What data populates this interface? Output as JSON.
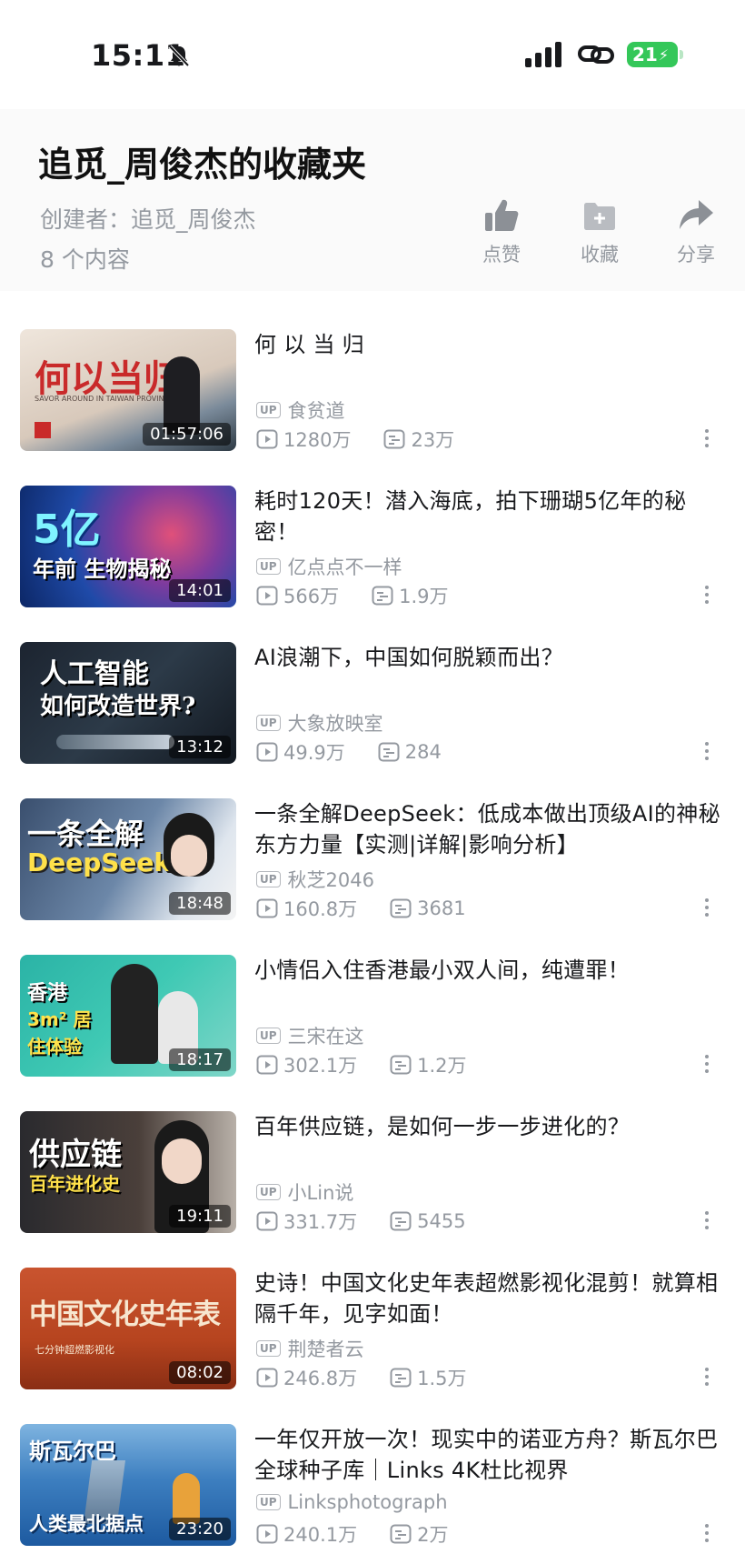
{
  "status": {
    "time": "15:11",
    "battery": "21"
  },
  "header": {
    "title": "追觅_周俊杰的收藏夹",
    "creator": "创建者：追觅_周俊杰",
    "count": "8 个内容",
    "actions": {
      "like": "点赞",
      "collect": "收藏",
      "share": "分享"
    }
  },
  "videos": [
    {
      "title": "何 以 当 归",
      "thumb_text": "何以当归",
      "thumb_sub": "SAVOR AROUND IN TAIWAN PROVINCE",
      "duration": "01:57:06",
      "up": "食贫道",
      "views": "1280万",
      "danmaku": "23万"
    },
    {
      "title": "耗时120天！潜入海底，拍下珊瑚5亿年的秘密！",
      "thumb_text": "5亿",
      "thumb_sub": "年前 生物揭秘",
      "duration": "14:01",
      "up": "亿点点不一样",
      "views": "566万",
      "danmaku": "1.9万"
    },
    {
      "title": "AI浪潮下，中国如何脱颖而出？",
      "thumb_text": "人工智能",
      "thumb_sub": "如何改造世界?",
      "duration": "13:12",
      "up": "大象放映室",
      "views": "49.9万",
      "danmaku": "284"
    },
    {
      "title": "一条全解DeepSeek：低成本做出顶级AI的神秘东方力量【实测|详解|影响分析】",
      "thumb_text": "一条全解",
      "thumb_sub": "DeepSeek",
      "duration": "18:48",
      "up": "秋芝2046",
      "views": "160.8万",
      "danmaku": "3681"
    },
    {
      "title": "小情侣入住香港最小双人间，纯遭罪！",
      "thumb_text": "香港",
      "thumb_sub": "3m² 居住体验",
      "duration": "18:17",
      "up": "三宋在这",
      "views": "302.1万",
      "danmaku": "1.2万"
    },
    {
      "title": "百年供应链，是如何一步一步进化的？",
      "thumb_text": "供应链",
      "thumb_sub": "百年进化史",
      "duration": "19:11",
      "up": "小Lin说",
      "views": "331.7万",
      "danmaku": "5455"
    },
    {
      "title": "史诗！中国文化史年表超燃影视化混剪！就算相隔千年，见字如面！",
      "thumb_text": "中国文化史年表",
      "thumb_sub": "七分钟超燃影视化",
      "duration": "08:02",
      "up": "荆楚者云",
      "views": "246.8万",
      "danmaku": "1.5万"
    },
    {
      "title": "一年仅开放一次！现实中的诺亚方舟？斯瓦尔巴全球种子库｜Links 4K杜比视界",
      "thumb_text": "斯瓦尔巴",
      "thumb_sub": "人类最北据点",
      "duration": "23:20",
      "up": "Linksphotograph",
      "views": "240.1万",
      "danmaku": "2万"
    }
  ],
  "colors": {
    "accent_battery": "#34c759",
    "meta_gray": "#9499a0"
  }
}
